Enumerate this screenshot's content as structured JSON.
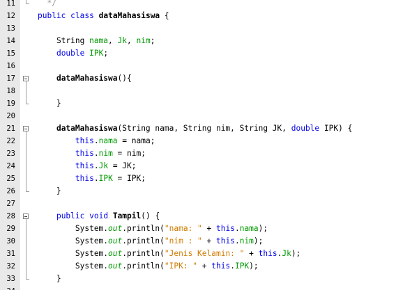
{
  "editor": {
    "lines": [
      {
        "no": "11",
        "tokens": [
          {
            "t": "  */",
            "c": "cmt"
          }
        ]
      },
      {
        "no": "12",
        "tokens": [
          {
            "t": "public",
            "c": "kw"
          },
          {
            "t": " "
          },
          {
            "t": "class",
            "c": "kw"
          },
          {
            "t": " "
          },
          {
            "t": "dataMahasiswa",
            "c": "bold"
          },
          {
            "t": " {"
          }
        ]
      },
      {
        "no": "13",
        "tokens": []
      },
      {
        "no": "14",
        "tokens": [
          {
            "t": "    String "
          },
          {
            "t": "nama",
            "c": "fld"
          },
          {
            "t": ", "
          },
          {
            "t": "Jk",
            "c": "fld"
          },
          {
            "t": ", "
          },
          {
            "t": "nim",
            "c": "fld"
          },
          {
            "t": ";"
          }
        ]
      },
      {
        "no": "15",
        "tokens": [
          {
            "t": "    "
          },
          {
            "t": "double",
            "c": "kw"
          },
          {
            "t": " "
          },
          {
            "t": "IPK",
            "c": "fld"
          },
          {
            "t": ";"
          }
        ]
      },
      {
        "no": "16",
        "tokens": []
      },
      {
        "no": "17",
        "tokens": [
          {
            "t": "    "
          },
          {
            "t": "dataMahasiswa",
            "c": "bold"
          },
          {
            "t": "(){"
          }
        ]
      },
      {
        "no": "18",
        "tokens": []
      },
      {
        "no": "19",
        "tokens": [
          {
            "t": "    }"
          }
        ]
      },
      {
        "no": "20",
        "tokens": []
      },
      {
        "no": "21",
        "tokens": [
          {
            "t": "    "
          },
          {
            "t": "dataMahasiswa",
            "c": "bold"
          },
          {
            "t": "(String nama, String nim, String JK, "
          },
          {
            "t": "double",
            "c": "kw"
          },
          {
            "t": " IPK) {"
          }
        ]
      },
      {
        "no": "22",
        "tokens": [
          {
            "t": "        "
          },
          {
            "t": "this",
            "c": "kw"
          },
          {
            "t": "."
          },
          {
            "t": "nama",
            "c": "fld"
          },
          {
            "t": " = nama;"
          }
        ]
      },
      {
        "no": "23",
        "tokens": [
          {
            "t": "        "
          },
          {
            "t": "this",
            "c": "kw"
          },
          {
            "t": "."
          },
          {
            "t": "nim",
            "c": "fld"
          },
          {
            "t": " = nim;"
          }
        ]
      },
      {
        "no": "24",
        "tokens": [
          {
            "t": "        "
          },
          {
            "t": "this",
            "c": "kw"
          },
          {
            "t": "."
          },
          {
            "t": "Jk",
            "c": "fld"
          },
          {
            "t": " = JK;"
          }
        ]
      },
      {
        "no": "25",
        "tokens": [
          {
            "t": "        "
          },
          {
            "t": "this",
            "c": "kw"
          },
          {
            "t": "."
          },
          {
            "t": "IPK",
            "c": "fld"
          },
          {
            "t": " = IPK;"
          }
        ]
      },
      {
        "no": "26",
        "tokens": [
          {
            "t": "    }"
          }
        ]
      },
      {
        "no": "27",
        "tokens": []
      },
      {
        "no": "28",
        "tokens": [
          {
            "t": "    "
          },
          {
            "t": "public",
            "c": "kw"
          },
          {
            "t": " "
          },
          {
            "t": "void",
            "c": "kw"
          },
          {
            "t": " "
          },
          {
            "t": "Tampil",
            "c": "bold"
          },
          {
            "t": "() {"
          }
        ]
      },
      {
        "no": "29",
        "tokens": [
          {
            "t": "        System."
          },
          {
            "t": "out",
            "c": "sfld"
          },
          {
            "t": ".println("
          },
          {
            "t": "\"nama: \"",
            "c": "str"
          },
          {
            "t": " + "
          },
          {
            "t": "this",
            "c": "kw"
          },
          {
            "t": "."
          },
          {
            "t": "nama",
            "c": "fld"
          },
          {
            "t": ");"
          }
        ]
      },
      {
        "no": "30",
        "tokens": [
          {
            "t": "        System."
          },
          {
            "t": "out",
            "c": "sfld"
          },
          {
            "t": ".println("
          },
          {
            "t": "\"nim : \"",
            "c": "str"
          },
          {
            "t": " + "
          },
          {
            "t": "this",
            "c": "kw"
          },
          {
            "t": "."
          },
          {
            "t": "nim",
            "c": "fld"
          },
          {
            "t": ");"
          }
        ]
      },
      {
        "no": "31",
        "tokens": [
          {
            "t": "        System."
          },
          {
            "t": "out",
            "c": "sfld"
          },
          {
            "t": ".println("
          },
          {
            "t": "\"Jenis Kelamin: \"",
            "c": "str"
          },
          {
            "t": " + "
          },
          {
            "t": "this",
            "c": "kw"
          },
          {
            "t": "."
          },
          {
            "t": "Jk",
            "c": "fld"
          },
          {
            "t": ");"
          }
        ]
      },
      {
        "no": "32",
        "tokens": [
          {
            "t": "        System."
          },
          {
            "t": "out",
            "c": "sfld"
          },
          {
            "t": ".println("
          },
          {
            "t": "\"IPK: \"",
            "c": "str"
          },
          {
            "t": " + "
          },
          {
            "t": "this",
            "c": "kw"
          },
          {
            "t": "."
          },
          {
            "t": "IPK",
            "c": "fld"
          },
          {
            "t": ");"
          }
        ]
      },
      {
        "no": "33",
        "tokens": [
          {
            "t": "    }"
          }
        ]
      },
      {
        "no": "34",
        "tokens": []
      }
    ],
    "colors": {
      "keyword": "#0000e6",
      "string": "#ce7b00",
      "field": "#009900",
      "comment": "#969696",
      "gutter": "#e9e9e9"
    },
    "folds": [
      {
        "start": "17",
        "end": "19"
      },
      {
        "start": "21",
        "end": "26"
      },
      {
        "start": "28",
        "end": "33"
      }
    ]
  }
}
